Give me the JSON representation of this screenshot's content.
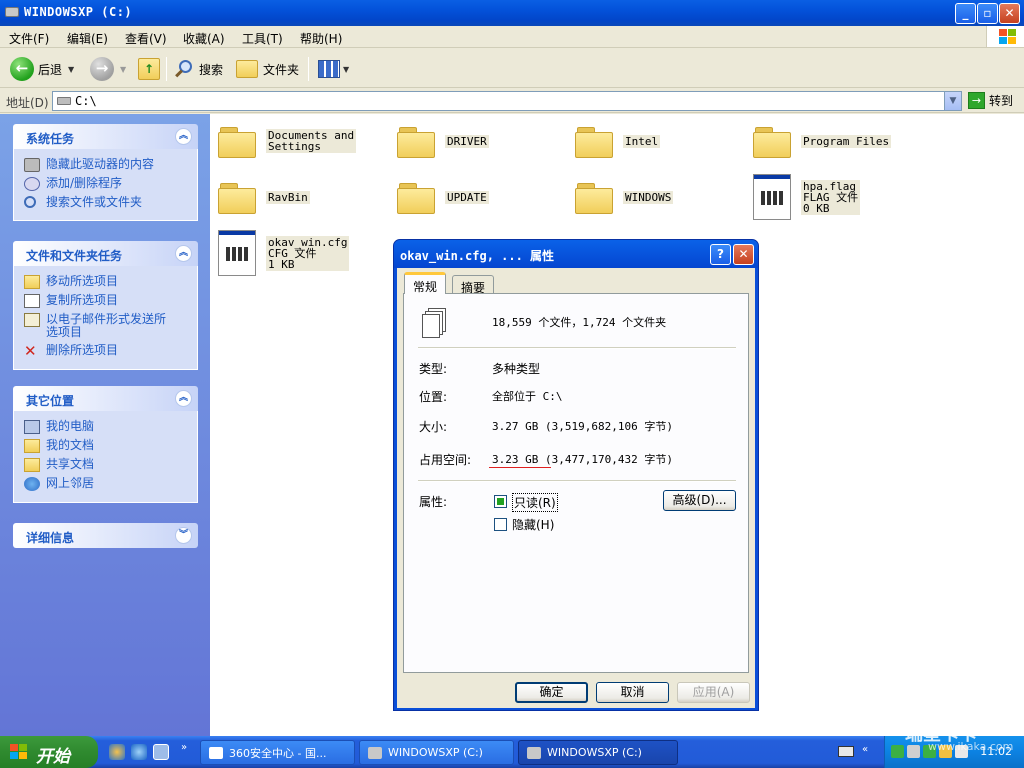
{
  "window": {
    "title": "WINDOWSXP  (C:)",
    "minimize": "_",
    "maximize": "▫",
    "close": "✕"
  },
  "menu": {
    "items": [
      "文件(F)",
      "编辑(E)",
      "查看(V)",
      "收藏(A)",
      "工具(T)",
      "帮助(H)"
    ]
  },
  "toolbar": {
    "back_label": "后退",
    "search_label": "搜索",
    "folders_label": "文件夹"
  },
  "address": {
    "label": "地址(D)",
    "value": "C:\\",
    "go_label": "转到"
  },
  "left_pane": {
    "system_tasks": {
      "title": "系统任务",
      "items": [
        "隐藏此驱动器的内容",
        "添加/删除程序",
        "搜索文件或文件夹"
      ]
    },
    "file_tasks": {
      "title": "文件和文件夹任务",
      "items": [
        "移动所选项目",
        "复制所选项目",
        "以电子邮件形式发送所选项目",
        "删除所选项目"
      ]
    },
    "other_places": {
      "title": "其它位置",
      "items": [
        "我的电脑",
        "我的文档",
        "共享文档",
        "网上邻居"
      ]
    },
    "details": {
      "title": "详细信息"
    }
  },
  "files": [
    {
      "name1": "Documents and",
      "name2": "Settings",
      "type": "folder"
    },
    {
      "name1": "DRIVER",
      "type": "folder"
    },
    {
      "name1": "Intel",
      "type": "folder"
    },
    {
      "name1": "Program Files",
      "type": "folder"
    },
    {
      "name1": "RavBin",
      "type": "folder"
    },
    {
      "name1": "UPDATE",
      "type": "folder"
    },
    {
      "name1": "WINDOWS",
      "type": "folder"
    },
    {
      "name1": "hpa.flag",
      "name2": "FLAG 文件",
      "name3": "0 KB",
      "type": "file"
    },
    {
      "name1": "okav_win.cfg",
      "name2": "CFG 文件",
      "name3": "1 KB",
      "type": "file"
    }
  ],
  "dialog": {
    "title": "okav_win.cfg, ... 属性",
    "help": "?",
    "close": "✕",
    "tabs": [
      "常规",
      "摘要"
    ],
    "summary": "18,559 个文件，1,724 个文件夹",
    "type_label": "类型:",
    "type_value": "多种类型",
    "location_label": "位置:",
    "location_value": "全部位于 C:\\",
    "size_label": "大小:",
    "size_value": "3.27 GB (3,519,682,106 字节)",
    "disk_label": "占用空间:",
    "disk_value": "3.23 GB (3,477,170,432 字节)",
    "attr_label": "属性:",
    "readonly_label": "只读(R)",
    "hidden_label": "隐藏(H)",
    "advanced_button": "高级(D)...",
    "ok_button": "确定",
    "cancel_button": "取消",
    "apply_button": "应用(A)"
  },
  "taskbar": {
    "start_label": "开始",
    "tasks": [
      "360安全中心 - 国...",
      "WINDOWSXP  (C:)",
      "WINDOWSXP  (C:)"
    ],
    "clock": "11:02"
  },
  "watermark": {
    "line1": "瑞星卡卡",
    "line2": "www.ikaka.com"
  }
}
